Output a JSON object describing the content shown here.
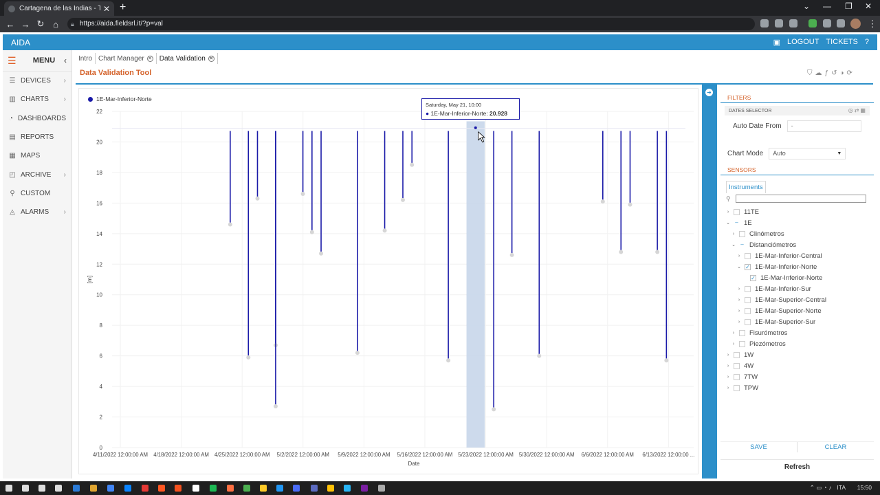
{
  "browser": {
    "tab_title": "Cartagena de las Indias - Tunel C",
    "tab_close": "✕",
    "new_tab": "+",
    "url": "https://aida.fieldsrl.it/?p=val",
    "min": "⌄",
    "minimize": "—",
    "restore": "❐",
    "close": "✕"
  },
  "app": {
    "brand": "AIDA",
    "logout": "LOGOUT",
    "tickets": "TICKETS",
    "help": "?"
  },
  "menu": {
    "label": "MENU",
    "items": [
      {
        "label": "DEVICES",
        "icon": "database-icon",
        "glyph": "☰",
        "arrow": "›"
      },
      {
        "label": "CHARTS",
        "icon": "bar-chart-icon",
        "glyph": "▥",
        "arrow": "›"
      },
      {
        "label": "DASHBOARDS",
        "icon": "dashboard-icon",
        "glyph": "◔",
        "arrow": ""
      },
      {
        "label": "REPORTS",
        "icon": "report-icon",
        "glyph": "▤",
        "arrow": ""
      },
      {
        "label": "MAPS",
        "icon": "map-icon",
        "glyph": "▦",
        "arrow": ""
      },
      {
        "label": "ARCHIVE",
        "icon": "archive-icon",
        "glyph": "◰",
        "arrow": "›"
      },
      {
        "label": "CUSTOM",
        "icon": "custom-icon",
        "glyph": "⚲",
        "arrow": ""
      },
      {
        "label": "ALARMS",
        "icon": "bell-icon",
        "glyph": "◬",
        "arrow": "›"
      }
    ]
  },
  "tabs": [
    {
      "label": "Intro",
      "closable": false
    },
    {
      "label": "Chart Manager",
      "closable": true
    },
    {
      "label": "Data Validation",
      "closable": true
    }
  ],
  "page": {
    "title": "Data Validation Tool"
  },
  "tooltip": {
    "date": "Saturday, May 21, 10:00",
    "series": "1E-Mar-Inferior-Norte:",
    "value": "20.928"
  },
  "filters": {
    "title": "FILTERS",
    "dates_selector": "DATES SELECTOR",
    "auto_date_from_label": "Auto Date From",
    "auto_date_from_value": "-",
    "chart_mode_label": "Chart Mode",
    "chart_mode_value": "Auto"
  },
  "sensors": {
    "title": "SENSORS",
    "tab": "Instruments",
    "tree": [
      {
        "label": "11TE",
        "indent": 0,
        "toggle": "›",
        "check": ""
      },
      {
        "label": "1E",
        "indent": 0,
        "toggle": "⌄",
        "check": "partial"
      },
      {
        "label": "Clinómetros",
        "indent": 1,
        "toggle": "›",
        "check": ""
      },
      {
        "label": "Distanciómetros",
        "indent": 1,
        "toggle": "⌄",
        "check": "partial"
      },
      {
        "label": "1E-Mar-Inferior-Central",
        "indent": 2,
        "toggle": "›",
        "check": ""
      },
      {
        "label": "1E-Mar-Inferior-Norte",
        "indent": 2,
        "toggle": "⌄",
        "check": "checked"
      },
      {
        "label": "1E-Mar-Inferior-Norte",
        "indent": 3,
        "toggle": "",
        "check": "checked"
      },
      {
        "label": "1E-Mar-Inferior-Sur",
        "indent": 2,
        "toggle": "›",
        "check": ""
      },
      {
        "label": "1E-Mar-Superior-Central",
        "indent": 2,
        "toggle": "›",
        "check": ""
      },
      {
        "label": "1E-Mar-Superior-Norte",
        "indent": 2,
        "toggle": "›",
        "check": ""
      },
      {
        "label": "1E-Mar-Superior-Sur",
        "indent": 2,
        "toggle": "›",
        "check": ""
      },
      {
        "label": "Fisurómetros",
        "indent": 1,
        "toggle": "›",
        "check": ""
      },
      {
        "label": "Piezómetros",
        "indent": 1,
        "toggle": "›",
        "check": ""
      },
      {
        "label": "1W",
        "indent": 0,
        "toggle": "›",
        "check": ""
      },
      {
        "label": "4W",
        "indent": 0,
        "toggle": "›",
        "check": ""
      },
      {
        "label": "7TW",
        "indent": 0,
        "toggle": "›",
        "check": ""
      },
      {
        "label": "TPW",
        "indent": 0,
        "toggle": "›",
        "check": ""
      }
    ],
    "save": "SAVE",
    "clear": "CLEAR",
    "refresh": "Refresh"
  },
  "taskbar": {
    "lang": "ITA",
    "time": "15:50"
  },
  "colors": {
    "accent": "#2c8fc9",
    "title": "#d4622a",
    "series": "#1a1aa8",
    "highlight": "#c8d6ea"
  },
  "chart_data": {
    "type": "line",
    "title": "",
    "xlabel": "Date",
    "ylabel": "[m]",
    "ylim": [
      0,
      22
    ],
    "y_ticks": [
      0,
      2,
      4,
      6,
      8,
      10,
      12,
      14,
      16,
      18,
      20,
      22
    ],
    "x_tick_labels": [
      "4/11/2022 12:00:00 AM",
      "4/18/2022 12:00:00 AM",
      "4/25/2022 12:00:00 AM",
      "5/2/2022 12:00:00 AM",
      "5/9/2022 12:00:00 AM",
      "5/16/2022 12:00:00 AM",
      "5/23/2022 12:00:00 AM",
      "5/30/2022 12:00:00 AM",
      "6/6/2022 12:00:00 AM",
      "6/13/2022 12:00:00 ..."
    ],
    "x_start": "2022-04-11",
    "x_end": "2022-06-14",
    "baseline": 20.9,
    "legend": [
      "1E-Mar-Inferior-Norte"
    ],
    "highlight_range": [
      "2022-05-20",
      "2022-05-22"
    ],
    "drops": [
      {
        "date": "2022-04-24",
        "value": 14.6
      },
      {
        "date": "2022-04-26",
        "value": 5.9
      },
      {
        "date": "2022-04-27",
        "value": 16.3
      },
      {
        "date": "2022-04-29",
        "value": 6.7
      },
      {
        "date": "2022-04-29",
        "value": 2.7
      },
      {
        "date": "2022-05-02",
        "value": 16.6
      },
      {
        "date": "2022-05-03",
        "value": 14.1
      },
      {
        "date": "2022-05-04",
        "value": 12.7
      },
      {
        "date": "2022-05-08",
        "value": 6.2
      },
      {
        "date": "2022-05-11",
        "value": 14.2
      },
      {
        "date": "2022-05-13",
        "value": 16.2
      },
      {
        "date": "2022-05-14",
        "value": 18.5
      },
      {
        "date": "2022-05-18",
        "value": 5.7
      },
      {
        "date": "2022-05-23",
        "value": 2.5
      },
      {
        "date": "2022-05-25",
        "value": 12.6
      },
      {
        "date": "2022-05-28",
        "value": 6.0
      },
      {
        "date": "2022-06-04",
        "value": 16.1
      },
      {
        "date": "2022-06-06",
        "value": 12.8
      },
      {
        "date": "2022-06-07",
        "value": 15.9
      },
      {
        "date": "2022-06-10",
        "value": 12.8
      },
      {
        "date": "2022-06-11",
        "value": 5.7
      },
      {
        "date": "2022-06-15",
        "value": 2.7
      }
    ],
    "tooltip_point": {
      "date": "2022-05-21",
      "value": 20.928
    },
    "end_point": {
      "date": "2022-06-17",
      "value": 20.9
    }
  }
}
